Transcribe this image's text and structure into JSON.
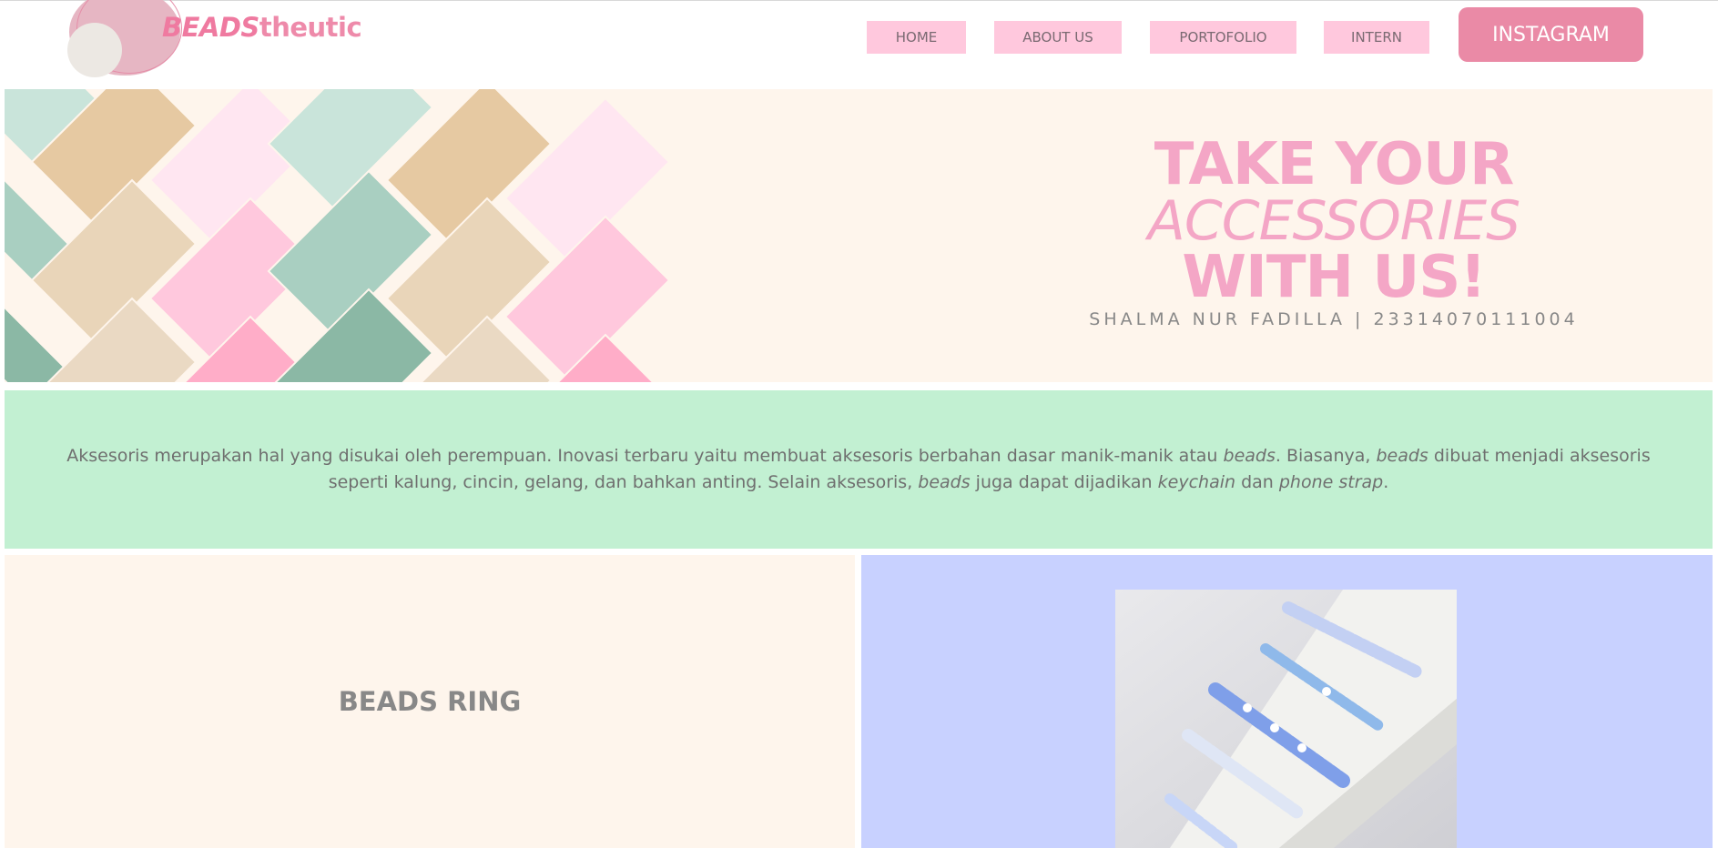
{
  "header": {
    "logo": {
      "prefix": "BEADS",
      "suffix": "theutic"
    },
    "nav": [
      {
        "label": "HOME"
      },
      {
        "label": "ABOUT US"
      },
      {
        "label": "PORTOFOLIO"
      },
      {
        "label": "INTERN"
      }
    ],
    "instagram_label": "INSTAGRAM"
  },
  "hero": {
    "line1": "TAKE YOUR",
    "line2": "ACCESSORIES",
    "line3": "WITH US!",
    "subtitle": "SHALMA NUR FADILLA | 23314070111004"
  },
  "description": {
    "s1": "Aksesoris merupakan hal yang disukai oleh perempuan. Inovasi terbaru yaitu membuat aksesoris berbahan dasar manik-manik atau ",
    "e1": "beads",
    "s2": ". Biasanya, ",
    "e2": "beads",
    "s3": " dibuat menjadi aksesoris seperti kalung, cincin, gelang, dan bahkan anting. Selain aksesoris, ",
    "e3": "beads",
    "s4": " juga dapat dijadikan ",
    "e4": "keychain",
    "s5": " dan ",
    "e5": "phone strap",
    "s6": "."
  },
  "product": {
    "title": "BEADS RING"
  },
  "colors": {
    "accent_pink": "#ea8aa6",
    "nav_pink": "#ffc8dd",
    "mint": "#c2f0d2",
    "cream": "#fef5ec",
    "periwinkle": "#c8d1ff"
  },
  "icons": {
    "logo": "circles-logo-icon",
    "photo": "beaded-rings-photo"
  }
}
